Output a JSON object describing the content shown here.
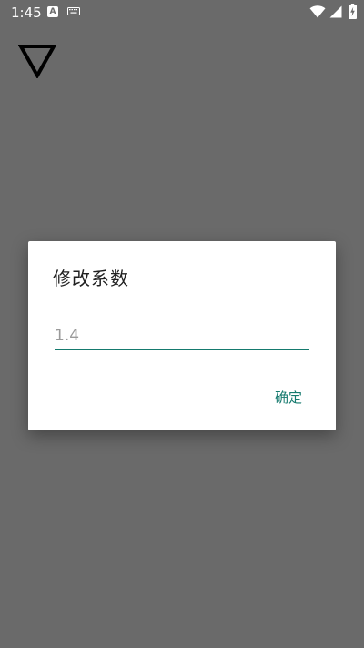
{
  "status_bar": {
    "time": "1:45",
    "notification_letter": "A",
    "icons": [
      "a-notification-icon",
      "keyboard-icon",
      "wifi-icon",
      "signal-icon",
      "battery-charging-icon"
    ]
  },
  "app": {
    "logo_icon": "triangle-down-icon"
  },
  "dialog": {
    "title": "修改系数",
    "input": {
      "value": "",
      "placeholder": "1.4"
    },
    "confirm_label": "确定"
  },
  "colors": {
    "scrim": "#6a6a6a",
    "accent": "#157a6e",
    "dialog_bg": "#ffffff",
    "title_text": "#212121",
    "hint_text": "#9a9a9a"
  }
}
